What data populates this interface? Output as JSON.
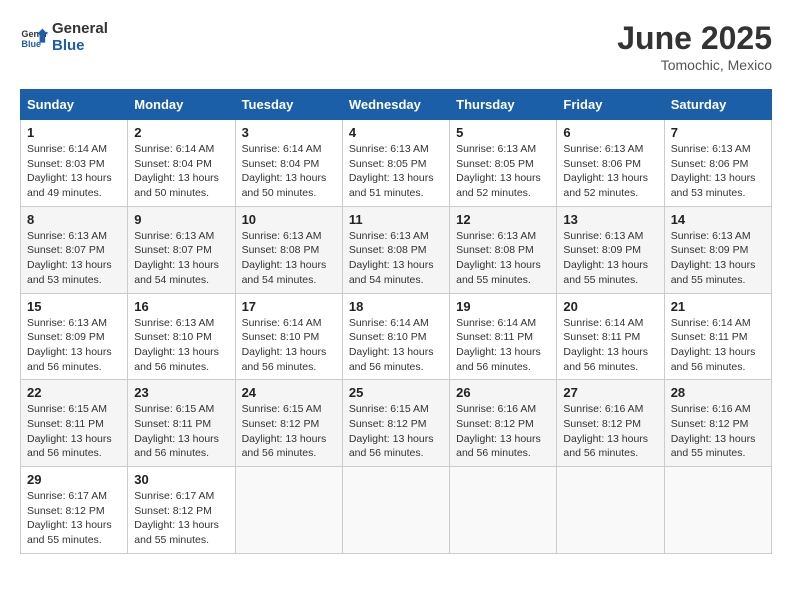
{
  "header": {
    "logo_line1": "General",
    "logo_line2": "Blue",
    "month": "June 2025",
    "location": "Tomochic, Mexico"
  },
  "weekdays": [
    "Sunday",
    "Monday",
    "Tuesday",
    "Wednesday",
    "Thursday",
    "Friday",
    "Saturday"
  ],
  "weeks": [
    [
      {
        "day": "1",
        "sunrise": "Sunrise: 6:14 AM",
        "sunset": "Sunset: 8:03 PM",
        "daylight": "Daylight: 13 hours and 49 minutes."
      },
      {
        "day": "2",
        "sunrise": "Sunrise: 6:14 AM",
        "sunset": "Sunset: 8:04 PM",
        "daylight": "Daylight: 13 hours and 50 minutes."
      },
      {
        "day": "3",
        "sunrise": "Sunrise: 6:14 AM",
        "sunset": "Sunset: 8:04 PM",
        "daylight": "Daylight: 13 hours and 50 minutes."
      },
      {
        "day": "4",
        "sunrise": "Sunrise: 6:13 AM",
        "sunset": "Sunset: 8:05 PM",
        "daylight": "Daylight: 13 hours and 51 minutes."
      },
      {
        "day": "5",
        "sunrise": "Sunrise: 6:13 AM",
        "sunset": "Sunset: 8:05 PM",
        "daylight": "Daylight: 13 hours and 52 minutes."
      },
      {
        "day": "6",
        "sunrise": "Sunrise: 6:13 AM",
        "sunset": "Sunset: 8:06 PM",
        "daylight": "Daylight: 13 hours and 52 minutes."
      },
      {
        "day": "7",
        "sunrise": "Sunrise: 6:13 AM",
        "sunset": "Sunset: 8:06 PM",
        "daylight": "Daylight: 13 hours and 53 minutes."
      }
    ],
    [
      {
        "day": "8",
        "sunrise": "Sunrise: 6:13 AM",
        "sunset": "Sunset: 8:07 PM",
        "daylight": "Daylight: 13 hours and 53 minutes."
      },
      {
        "day": "9",
        "sunrise": "Sunrise: 6:13 AM",
        "sunset": "Sunset: 8:07 PM",
        "daylight": "Daylight: 13 hours and 54 minutes."
      },
      {
        "day": "10",
        "sunrise": "Sunrise: 6:13 AM",
        "sunset": "Sunset: 8:08 PM",
        "daylight": "Daylight: 13 hours and 54 minutes."
      },
      {
        "day": "11",
        "sunrise": "Sunrise: 6:13 AM",
        "sunset": "Sunset: 8:08 PM",
        "daylight": "Daylight: 13 hours and 54 minutes."
      },
      {
        "day": "12",
        "sunrise": "Sunrise: 6:13 AM",
        "sunset": "Sunset: 8:08 PM",
        "daylight": "Daylight: 13 hours and 55 minutes."
      },
      {
        "day": "13",
        "sunrise": "Sunrise: 6:13 AM",
        "sunset": "Sunset: 8:09 PM",
        "daylight": "Daylight: 13 hours and 55 minutes."
      },
      {
        "day": "14",
        "sunrise": "Sunrise: 6:13 AM",
        "sunset": "Sunset: 8:09 PM",
        "daylight": "Daylight: 13 hours and 55 minutes."
      }
    ],
    [
      {
        "day": "15",
        "sunrise": "Sunrise: 6:13 AM",
        "sunset": "Sunset: 8:09 PM",
        "daylight": "Daylight: 13 hours and 56 minutes."
      },
      {
        "day": "16",
        "sunrise": "Sunrise: 6:13 AM",
        "sunset": "Sunset: 8:10 PM",
        "daylight": "Daylight: 13 hours and 56 minutes."
      },
      {
        "day": "17",
        "sunrise": "Sunrise: 6:14 AM",
        "sunset": "Sunset: 8:10 PM",
        "daylight": "Daylight: 13 hours and 56 minutes."
      },
      {
        "day": "18",
        "sunrise": "Sunrise: 6:14 AM",
        "sunset": "Sunset: 8:10 PM",
        "daylight": "Daylight: 13 hours and 56 minutes."
      },
      {
        "day": "19",
        "sunrise": "Sunrise: 6:14 AM",
        "sunset": "Sunset: 8:11 PM",
        "daylight": "Daylight: 13 hours and 56 minutes."
      },
      {
        "day": "20",
        "sunrise": "Sunrise: 6:14 AM",
        "sunset": "Sunset: 8:11 PM",
        "daylight": "Daylight: 13 hours and 56 minutes."
      },
      {
        "day": "21",
        "sunrise": "Sunrise: 6:14 AM",
        "sunset": "Sunset: 8:11 PM",
        "daylight": "Daylight: 13 hours and 56 minutes."
      }
    ],
    [
      {
        "day": "22",
        "sunrise": "Sunrise: 6:15 AM",
        "sunset": "Sunset: 8:11 PM",
        "daylight": "Daylight: 13 hours and 56 minutes."
      },
      {
        "day": "23",
        "sunrise": "Sunrise: 6:15 AM",
        "sunset": "Sunset: 8:11 PM",
        "daylight": "Daylight: 13 hours and 56 minutes."
      },
      {
        "day": "24",
        "sunrise": "Sunrise: 6:15 AM",
        "sunset": "Sunset: 8:12 PM",
        "daylight": "Daylight: 13 hours and 56 minutes."
      },
      {
        "day": "25",
        "sunrise": "Sunrise: 6:15 AM",
        "sunset": "Sunset: 8:12 PM",
        "daylight": "Daylight: 13 hours and 56 minutes."
      },
      {
        "day": "26",
        "sunrise": "Sunrise: 6:16 AM",
        "sunset": "Sunset: 8:12 PM",
        "daylight": "Daylight: 13 hours and 56 minutes."
      },
      {
        "day": "27",
        "sunrise": "Sunrise: 6:16 AM",
        "sunset": "Sunset: 8:12 PM",
        "daylight": "Daylight: 13 hours and 56 minutes."
      },
      {
        "day": "28",
        "sunrise": "Sunrise: 6:16 AM",
        "sunset": "Sunset: 8:12 PM",
        "daylight": "Daylight: 13 hours and 55 minutes."
      }
    ],
    [
      {
        "day": "29",
        "sunrise": "Sunrise: 6:17 AM",
        "sunset": "Sunset: 8:12 PM",
        "daylight": "Daylight: 13 hours and 55 minutes."
      },
      {
        "day": "30",
        "sunrise": "Sunrise: 6:17 AM",
        "sunset": "Sunset: 8:12 PM",
        "daylight": "Daylight: 13 hours and 55 minutes."
      },
      {
        "day": "",
        "sunrise": "",
        "sunset": "",
        "daylight": ""
      },
      {
        "day": "",
        "sunrise": "",
        "sunset": "",
        "daylight": ""
      },
      {
        "day": "",
        "sunrise": "",
        "sunset": "",
        "daylight": ""
      },
      {
        "day": "",
        "sunrise": "",
        "sunset": "",
        "daylight": ""
      },
      {
        "day": "",
        "sunrise": "",
        "sunset": "",
        "daylight": ""
      }
    ]
  ]
}
